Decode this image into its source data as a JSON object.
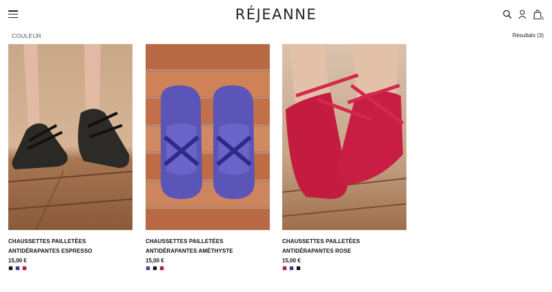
{
  "header": {
    "logo": "RÉJEANNE",
    "cart_count": "0"
  },
  "icons": {
    "menu": "hamburger-menu-icon",
    "search": "search-icon",
    "account": "user-icon",
    "cart": "shopping-bag-icon"
  },
  "filter": {
    "label": "COULEUR"
  },
  "results": {
    "label": "Résultats (3)"
  },
  "products": [
    {
      "name": "CHAUSSETTES PAILLETÉES ANTIDÉRAPANTES ESPRESSO",
      "price": "15,00 €",
      "swatches": [
        "#111111",
        "#3b3a7a",
        "#b0174a"
      ]
    },
    {
      "name": "CHAUSSETTES PAILLETÉES ANTIDÉRAPANTES AMÉTHYSTE",
      "price": "15,00 €",
      "swatches": [
        "#4b3f9a",
        "#111111",
        "#b0174a"
      ]
    },
    {
      "name": "CHAUSSETTES PAILLETÉES ANTIDÉRAPANTES ROSE",
      "price": "15,00 €",
      "swatches": [
        "#b0174a",
        "#3b3a7a",
        "#111111"
      ]
    }
  ]
}
